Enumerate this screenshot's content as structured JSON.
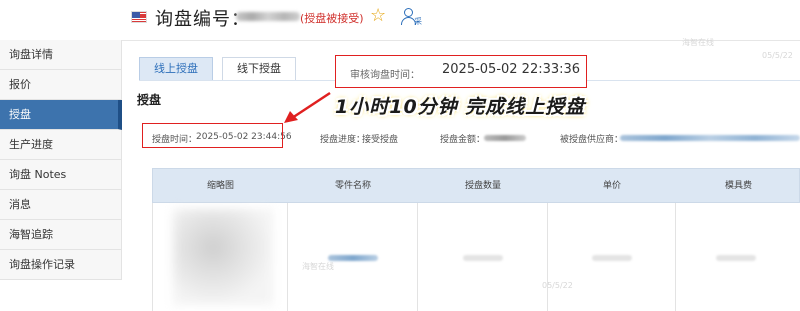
{
  "header": {
    "title": "询盘编号：",
    "status": "(授盘被接受)",
    "star_icon": "star-icon",
    "person_icon": "person-icon",
    "person_label": "采"
  },
  "sidebar": {
    "items": [
      {
        "label": "询盘详情",
        "active": false
      },
      {
        "label": "报价",
        "active": false
      },
      {
        "label": "授盘",
        "active": true
      },
      {
        "label": "生产进度",
        "active": false
      },
      {
        "label": "询盘 Notes",
        "active": false
      },
      {
        "label": "消息",
        "active": false
      },
      {
        "label": "海智追踪",
        "active": false
      },
      {
        "label": "询盘操作记录",
        "active": false
      }
    ]
  },
  "tabs": [
    {
      "label": "线上授盘",
      "active": true
    },
    {
      "label": "线下授盘",
      "active": false
    }
  ],
  "section_title": "授盘",
  "info": {
    "time_label": "授盘时间：",
    "time_value": "2025-05-02 23:44:56",
    "progress_label": "授盘进度：",
    "progress_value": "接受授盘",
    "amount_label": "授盘金额：",
    "supplier_label": "被授盘供应商："
  },
  "table": {
    "headers": [
      "缩略图",
      "零件名称",
      "授盘数量",
      "单价",
      "模具费"
    ]
  },
  "annotation": {
    "review_label": "审核询盘时间：",
    "review_time": "2025-05-02 22:33:36",
    "callout": "1小时10分钟 完成线上授盘",
    "colors": {
      "box": "#e02020",
      "highlight": "#f3d64b"
    }
  },
  "watermarks": [
    "海智在线",
    "05/5/22"
  ]
}
